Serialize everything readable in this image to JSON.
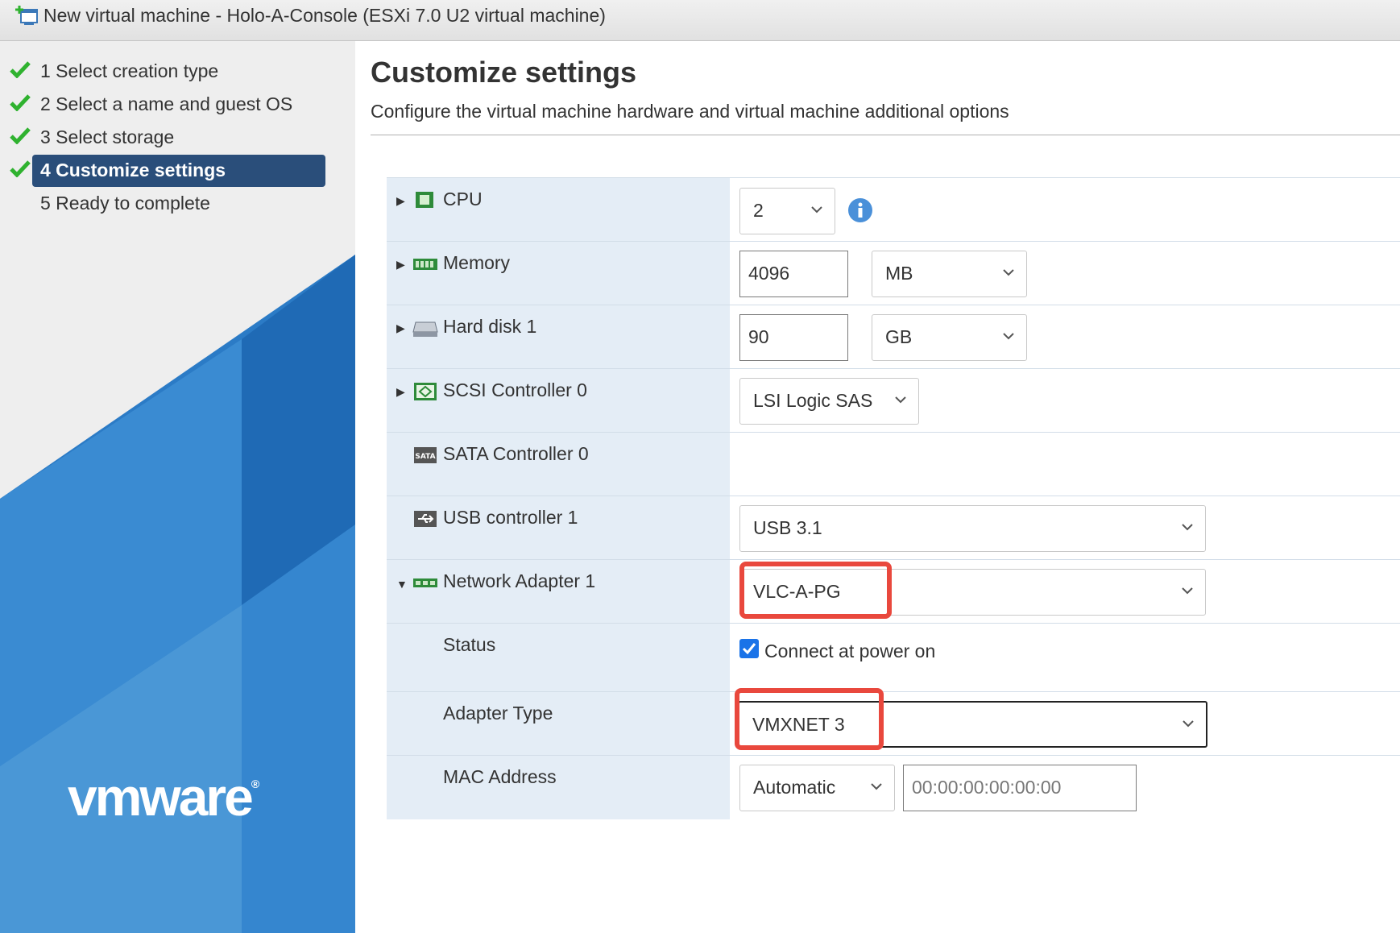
{
  "window": {
    "title": "New virtual machine - Holo-A-Console (ESXi 7.0 U2 virtual machine)"
  },
  "wizard": {
    "steps": [
      {
        "label": "1  Select creation type",
        "done": true
      },
      {
        "label": "2  Select a name and guest OS",
        "done": true
      },
      {
        "label": "3  Select storage",
        "done": true
      },
      {
        "label": "4 Customize settings",
        "done": true,
        "active": true
      },
      {
        "label": "5  Ready to complete",
        "done": false
      }
    ],
    "brand": "vmware"
  },
  "main": {
    "title": "Customize settings",
    "subtitle": "Configure the virtual machine hardware and virtual machine additional options"
  },
  "hardware": {
    "cpu": {
      "label": "CPU",
      "value": "2"
    },
    "memory": {
      "label": "Memory",
      "value": "4096",
      "unit": "MB"
    },
    "hard_disk": {
      "label": "Hard disk 1",
      "value": "90",
      "unit": "GB"
    },
    "scsi": {
      "label": "SCSI Controller 0",
      "value": "LSI Logic SAS"
    },
    "sata": {
      "label": "SATA Controller 0"
    },
    "usb": {
      "label": "USB controller 1",
      "value": "USB 3.1"
    },
    "network": {
      "label": "Network Adapter 1",
      "value": "VLC-A-PG",
      "status_label": "Status",
      "status_checkbox": "Connect at power on",
      "status_checked": true,
      "adapter_type_label": "Adapter Type",
      "adapter_type": "VMXNET 3",
      "mac_label": "MAC Address",
      "mac_mode": "Automatic",
      "mac_value": "00:00:00:00:00:00"
    }
  },
  "colors": {
    "active_step": "#2a4e7a",
    "check_green": "#2fb22f",
    "highlight_red": "#e9483d",
    "row_label_bg": "#e4edf6",
    "vmware_blue": "#2b7bc6"
  }
}
